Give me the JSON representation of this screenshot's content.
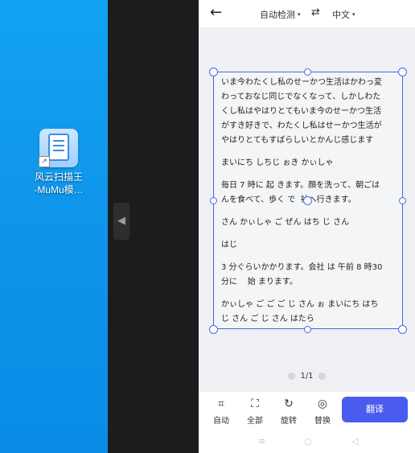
{
  "desktop": {
    "shortcut_icon": {
      "label": "风云扫描王\n-MuMu模…",
      "icon": "scanner-app-icon"
    }
  },
  "emulator": {
    "collapse_icon": "triangle-left-icon"
  },
  "app": {
    "topbar": {
      "back_icon": "arrow-left-icon",
      "back_glyph": "←",
      "source_language": "自动检测",
      "swap_glyph": "⇄",
      "target_language": "中文",
      "caret_glyph": "▾"
    },
    "document": {
      "lines": [
        "いま今わたくし私のせーかつ生活はかわっ変",
        "わっておなじ同じでなくなって、しかしわた",
        "くし私はやはりとてもいま今のせーかつ生活",
        "がすき好きで、わたくし私はせーかつ生活が",
        "やはりとてもすばらしいとかんじ感じます",
        "まいにち しちじ ぉき かぃしゃ",
        "毎日 7 時に 起 きます。顔を洗って、朝ごは",
        "んを食べて、歩く で  社へ行きます。",
        "さん かぃしゃ ご ぜん はち じ さん",
        "はじ",
        "3 分ぐらいかかります。会社 は 午前 8 時30",
        "分に    始 まります。",
        "かぃしゃ ご ご ご じ さん ぉ まいにち はち",
        "じ さん ご じ さん はたら"
      ]
    },
    "pager": {
      "text": "1/1"
    },
    "tools": [
      {
        "label": "自动",
        "icon": "auto-crop-icon",
        "glyph": "⌗"
      },
      {
        "label": "全部",
        "icon": "select-all-icon",
        "glyph": "⛶"
      },
      {
        "label": "旋转",
        "icon": "rotate-icon",
        "glyph": "↻"
      },
      {
        "label": "替换",
        "icon": "camera-icon",
        "glyph": "◎"
      }
    ],
    "translate_button": "翻译",
    "navbar": {
      "menu": "≡",
      "home": "○",
      "back": "◁"
    }
  },
  "colors": {
    "accent": "#4a5cf0",
    "crop_border": "#4a67e8",
    "desktop_bg": "#0f97ec",
    "emulator_bg": "#1c1c1c"
  }
}
